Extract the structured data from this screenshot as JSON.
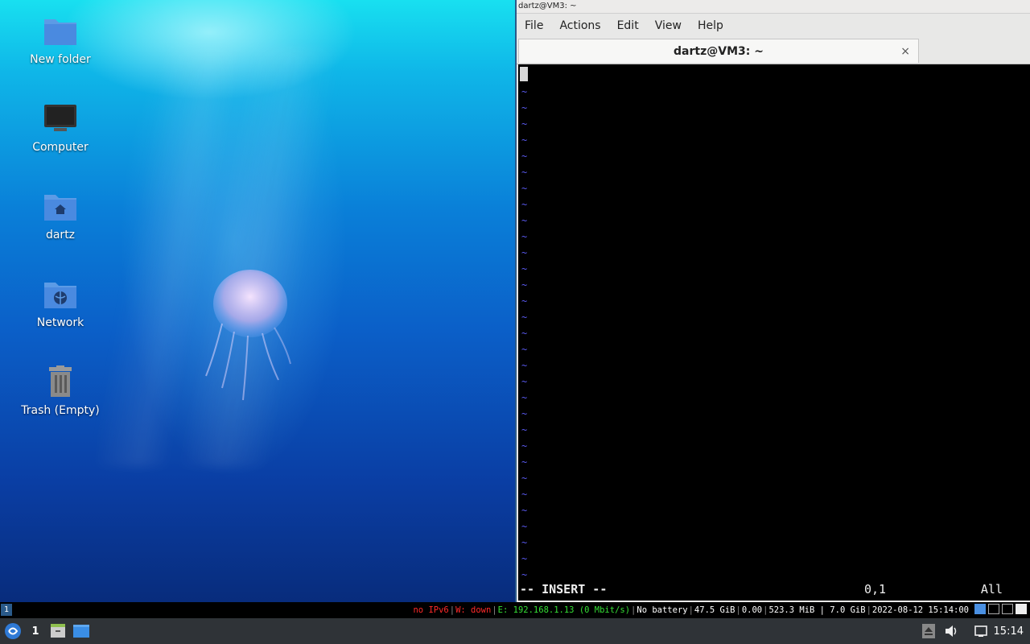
{
  "desktop": {
    "icons": [
      {
        "label": "New folder",
        "icon": "folder-icon"
      },
      {
        "label": "Computer",
        "icon": "computer-icon"
      },
      {
        "label": "dartz",
        "icon": "home-folder-icon"
      },
      {
        "label": "Network",
        "icon": "network-folder-icon"
      },
      {
        "label": "Trash (Empty)",
        "icon": "trash-icon"
      }
    ]
  },
  "window": {
    "title": "dartz@VM3: ~",
    "menu": [
      "File",
      "Actions",
      "Edit",
      "View",
      "Help"
    ],
    "tab_label": "dartz@VM3: ~",
    "tab_close": "×"
  },
  "terminal": {
    "empty_line_marker": "~",
    "mode": "-- INSERT --",
    "position": "0,1",
    "scroll": "All"
  },
  "statusbar": {
    "workspace": "1",
    "ipv6": "no IPv6",
    "wireless": "W: down",
    "ethernet": "E: 192.168.1.13 (0 Mbit/s)",
    "battery": "No battery",
    "disk": "47.5 GiB",
    "load": "0.00",
    "memory": "523.3 MiB | 7.0 GiB",
    "datetime": "2022-08-12 15:14:00",
    "colors": {
      "ipv6": "#ff2a2a",
      "wireless": "#ff2a2a",
      "ethernet": "#35e035"
    }
  },
  "taskbar": {
    "workspace": "1",
    "clock": "15:14"
  }
}
